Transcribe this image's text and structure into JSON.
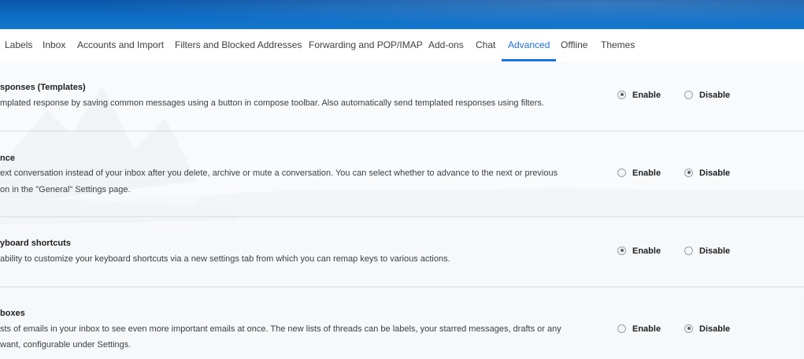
{
  "tabs": [
    {
      "label": "Labels"
    },
    {
      "label": "Inbox"
    },
    {
      "label": "Accounts and Import"
    },
    {
      "label": "Filters and Blocked Addresses"
    },
    {
      "label": "Forwarding and POP/IMAP"
    },
    {
      "label": "Add-ons"
    },
    {
      "label": "Chat"
    },
    {
      "label": "Advanced"
    },
    {
      "label": "Offline"
    },
    {
      "label": "Themes"
    }
  ],
  "active_tab": "Advanced",
  "settings": [
    {
      "title": "sponses (Templates)",
      "desc": [
        "mplated response by saving common messages using a button in compose toolbar. Also automatically send templated responses using filters."
      ],
      "enable_label": "Enable",
      "disable_label": "Disable",
      "selected": "enable"
    },
    {
      "title": "nce",
      "desc": [
        "ext conversation instead of your inbox after you delete, archive or mute a conversation. You can select whether to advance to the next or previous",
        "on in the \"General\" Settings page."
      ],
      "enable_label": "Enable",
      "disable_label": "Disable",
      "selected": "disable"
    },
    {
      "title": "yboard shortcuts",
      "desc": [
        "ability to customize your keyboard shortcuts via a new settings tab from which you can remap keys to various actions."
      ],
      "enable_label": "Enable",
      "disable_label": "Disable",
      "selected": "enable"
    },
    {
      "title": "boxes",
      "desc": [
        "sts of emails in your inbox to see even more important emails at once. The new lists of threads can be labels, your starred messages, drafts or any",
        "want, configurable under Settings."
      ],
      "enable_label": "Enable",
      "disable_label": "Disable",
      "selected": "disable"
    }
  ],
  "colors": {
    "accent": "#1a73e8",
    "banner": "#0f6dc5"
  }
}
